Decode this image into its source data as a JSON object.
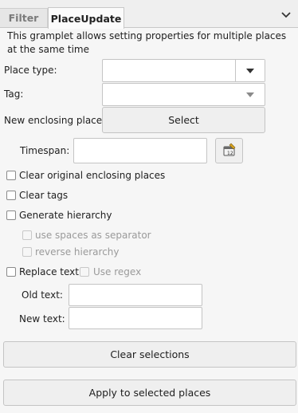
{
  "tabs": {
    "filter": "Filter",
    "placeupdate": "PlaceUpdate"
  },
  "description": "This gramplet allows setting properties for multiple places at the same time",
  "place_type": {
    "label": "Place type:",
    "value": ""
  },
  "tag": {
    "label": "Tag:",
    "value": ""
  },
  "enclosing": {
    "label": "New enclosing place",
    "button": "Select"
  },
  "timespan": {
    "label": "Timespan:",
    "value": ""
  },
  "options": {
    "clear_enclosing": "Clear original enclosing places",
    "clear_tags": "Clear tags",
    "generate_hierarchy": "Generate hierarchy",
    "use_spaces": "use spaces as separator",
    "reverse_hierarchy": "reverse hierarchy",
    "replace_text": "Replace text",
    "use_regex": "Use regex"
  },
  "replace": {
    "old_label": "Old text:",
    "old_value": "",
    "new_label": "New text:",
    "new_value": ""
  },
  "buttons": {
    "clear": "Clear selections",
    "apply": "Apply to selected places"
  }
}
